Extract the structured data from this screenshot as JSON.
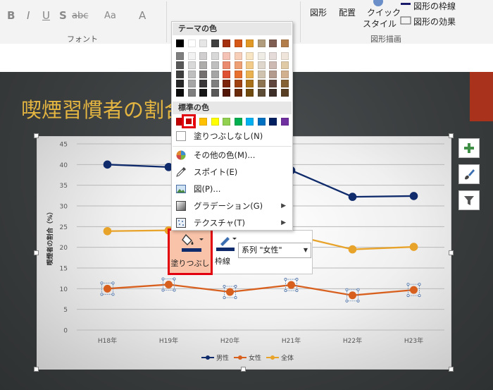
{
  "ribbon": {
    "font_group_label": "フォント",
    "drawing_group_label": "図形描画",
    "buttons": {
      "shape": "図形",
      "arrange": "配置",
      "quick_style_1": "クイック",
      "quick_style_2": "スタイル",
      "shape_outline": "図形の枠線",
      "shape_effects": "図形の効果"
    },
    "format_glyphs": {
      "bold": "B",
      "italic": "I",
      "underline": "U",
      "shadow": "S",
      "char_spacing": "abc",
      "case": "Aa",
      "font_color": "A"
    }
  },
  "slide": {
    "title": "喫煙習慣者の割合"
  },
  "chart_data": {
    "type": "line",
    "categories": [
      "H18年",
      "H19年",
      "H20年",
      "H21年",
      "H22年",
      "H23年"
    ],
    "series": [
      {
        "name": "男性",
        "color": "#0f2b6b",
        "values": [
          40.0,
          39.4,
          null,
          38.6,
          32.2,
          32.4
        ]
      },
      {
        "name": "女性",
        "color": "#d8601e",
        "values": [
          10.0,
          11.0,
          9.2,
          10.9,
          8.4,
          9.7
        ]
      },
      {
        "name": "全体",
        "color": "#e8a32a",
        "values": [
          23.9,
          24.1,
          null,
          23.0,
          19.5,
          20.1
        ]
      }
    ],
    "ylabel": "喫煙者の割合（%）",
    "ylim": [
      0,
      45
    ],
    "yticks": [
      "0",
      "5",
      "10",
      "15",
      "20",
      "25",
      "30",
      "35",
      "40",
      "45"
    ],
    "grid": true,
    "legend_position": "bottom"
  },
  "mini_toolbar": {
    "fill_label": "塗りつぶし",
    "outline_label": "枠線",
    "series_select_value": "系列 \"女性\""
  },
  "color_menu": {
    "theme_header": "テーマの色",
    "standard_header": "標準の色",
    "theme_top_colors": [
      "#000000",
      "#ffffff",
      "#e7e6e6",
      "#3f3f3f",
      "#a5300f",
      "#d55816",
      "#e19825",
      "#b19c7d",
      "#7f5f52",
      "#b27d49"
    ],
    "theme_shades": [
      [
        "#7f7f7f",
        "#f2f2f2",
        "#d0cece",
        "#d8d8d8",
        "#f4c3b5",
        "#f7cfb9",
        "#f8e5c4",
        "#efebe5",
        "#e5dcd9",
        "#f0e5da"
      ],
      [
        "#595959",
        "#d9d9d9",
        "#aeabab",
        "#bfbfbf",
        "#ea8a6e",
        "#ef9f74",
        "#f2cb8a",
        "#dfd7cb",
        "#ccbab3",
        "#e0caa5"
      ],
      [
        "#3f3f3f",
        "#bfbfbf",
        "#757070",
        "#a5a5a5",
        "#df5032",
        "#e7702f",
        "#eab150",
        "#cfc3b0",
        "#b29a8e",
        "#d1b090"
      ],
      [
        "#262626",
        "#a5a5a5",
        "#3a3838",
        "#7f7f7f",
        "#7b230b",
        "#9f4110",
        "#a87018",
        "#8d7450",
        "#5f473d",
        "#856136"
      ],
      [
        "#0c0c0c",
        "#7f7f7f",
        "#171616",
        "#595959",
        "#521707",
        "#6a2b0b",
        "#704b10",
        "#5e4d36",
        "#3f2f29",
        "#594024"
      ]
    ],
    "standard_colors": [
      "#c00000",
      "#ff0000",
      "#ffc000",
      "#ffff00",
      "#92d050",
      "#00b050",
      "#00b0f0",
      "#0070c0",
      "#002060",
      "#7030a0"
    ],
    "items": {
      "no_fill": "塗りつぶしなし(N)",
      "more_colors": "その他の色(M)...",
      "eyedropper": "スポイト(E)",
      "picture": "図(P)...",
      "gradient": "グラデーション(G)",
      "texture": "テクスチャ(T)"
    }
  }
}
